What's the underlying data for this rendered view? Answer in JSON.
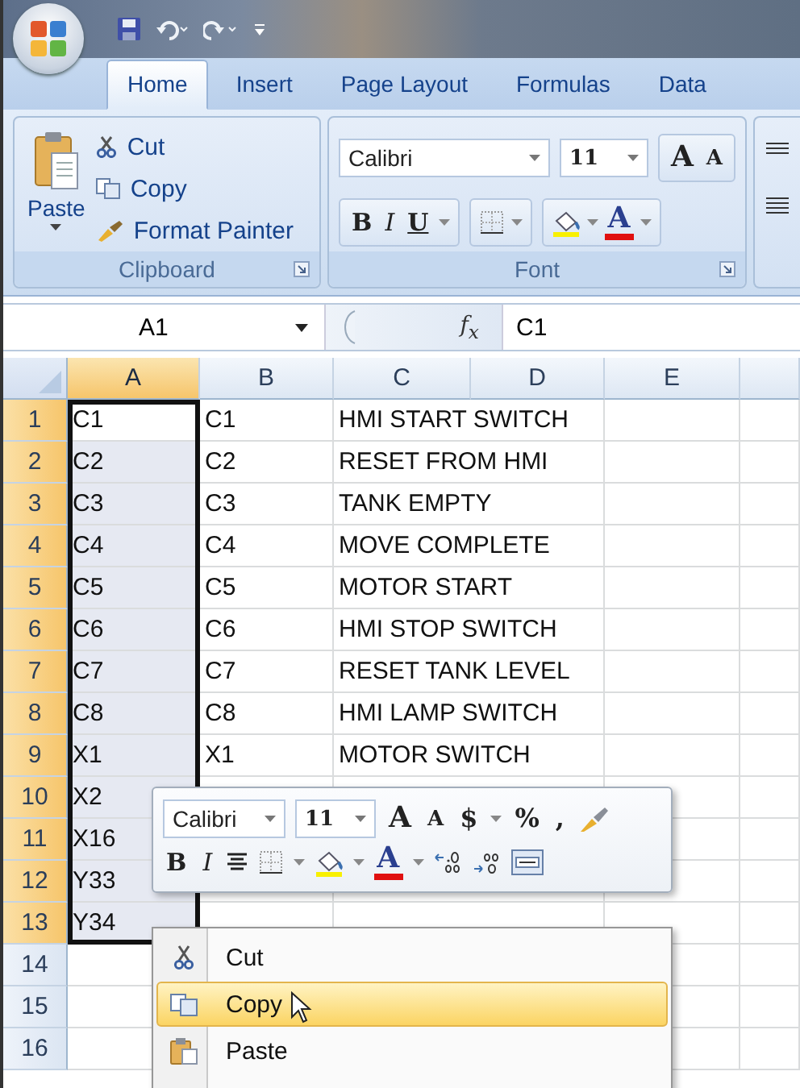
{
  "tabs": [
    {
      "label": "Home",
      "selected": true
    },
    {
      "label": "Insert",
      "selected": false
    },
    {
      "label": "Page Layout",
      "selected": false
    },
    {
      "label": "Formulas",
      "selected": false
    },
    {
      "label": "Data",
      "selected": false
    }
  ],
  "clipboard_group": {
    "label": "Clipboard",
    "paste": "Paste",
    "cut": "Cut",
    "copy": "Copy",
    "format_painter": "Format Painter"
  },
  "font_group": {
    "label": "Font",
    "font_name": "Calibri",
    "font_size": "11",
    "grow": "A",
    "shrink": "A",
    "bold": "B",
    "italic": "I",
    "underline": "U",
    "font_color": "A"
  },
  "formula_bar": {
    "name_box": "A1",
    "function_label": "f$_{x}$",
    "formula": "C1"
  },
  "sheet": {
    "columns": [
      {
        "label": "A",
        "selected": true
      },
      {
        "label": "B",
        "selected": false
      },
      {
        "label": "C",
        "selected": false
      },
      {
        "label": "D",
        "selected": false
      },
      {
        "label": "E",
        "selected": false
      }
    ],
    "rows": [
      {
        "number": "1",
        "selected": true,
        "active": true,
        "cells": [
          "C1",
          "C1",
          "HMI START SWITCH"
        ]
      },
      {
        "number": "2",
        "selected": true,
        "active": false,
        "cells": [
          "C2",
          "C2",
          "RESET FROM HMI"
        ]
      },
      {
        "number": "3",
        "selected": true,
        "active": false,
        "cells": [
          "C3",
          "C3",
          "TANK EMPTY"
        ]
      },
      {
        "number": "4",
        "selected": true,
        "active": false,
        "cells": [
          "C4",
          "C4",
          "MOVE COMPLETE"
        ]
      },
      {
        "number": "5",
        "selected": true,
        "active": false,
        "cells": [
          "C5",
          "C5",
          "MOTOR START"
        ]
      },
      {
        "number": "6",
        "selected": true,
        "active": false,
        "cells": [
          "C6",
          "C6",
          "HMI STOP SWITCH"
        ]
      },
      {
        "number": "7",
        "selected": true,
        "active": false,
        "cells": [
          "C7",
          "C7",
          "RESET TANK LEVEL"
        ]
      },
      {
        "number": "8",
        "selected": true,
        "active": false,
        "cells": [
          "C8",
          "C8",
          "HMI LAMP SWITCH"
        ]
      },
      {
        "number": "9",
        "selected": true,
        "active": false,
        "cells": [
          "X1",
          "X1",
          "MOTOR SWITCH"
        ]
      },
      {
        "number": "10",
        "selected": true,
        "active": false,
        "cells": [
          "X2"
        ]
      },
      {
        "number": "11",
        "selected": true,
        "active": false,
        "cells": [
          "X16"
        ]
      },
      {
        "number": "12",
        "selected": true,
        "active": false,
        "cells": [
          "Y33"
        ]
      },
      {
        "number": "13",
        "selected": true,
        "active": false,
        "cells": [
          "Y34"
        ]
      },
      {
        "number": "14",
        "selected": false,
        "active": false,
        "cells": []
      },
      {
        "number": "15",
        "selected": false,
        "active": false,
        "cells": []
      },
      {
        "number": "16",
        "selected": false,
        "active": false,
        "cells": []
      }
    ]
  },
  "mini_toolbar": {
    "font_name": "Calibri",
    "font_size": "11",
    "grow": "A",
    "shrink": "A",
    "currency": "$",
    "percent": "%",
    "comma": ",",
    "bold": "B",
    "italic": "I",
    "font_color": "A"
  },
  "context_menu": [
    {
      "label": "Cut",
      "selected": false,
      "kind": "cut"
    },
    {
      "label": "Copy",
      "selected": true,
      "kind": "copy"
    },
    {
      "label": "Paste",
      "selected": false,
      "kind": "paste"
    }
  ]
}
